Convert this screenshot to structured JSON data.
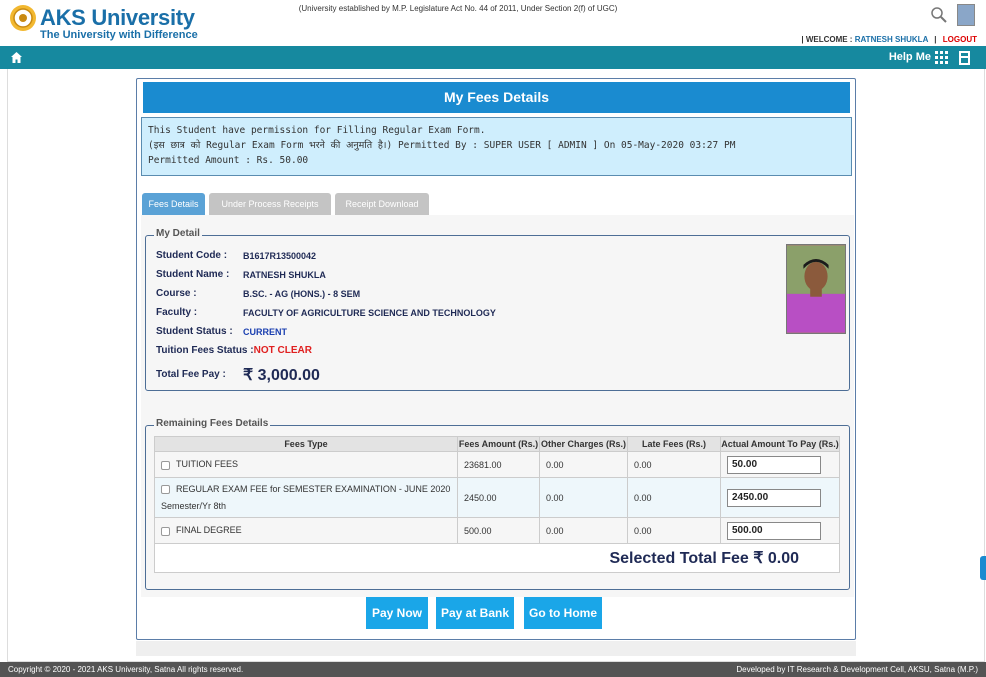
{
  "header": {
    "brand": "AKS University",
    "tagline": "The University with Difference",
    "establishment": "(University established by M.P. Legislature Act No. 44 of 2011, Under Section 2(f) of UGC)",
    "welcome_label": "WELCOME :",
    "user_name": "RATNESH SHUKLA",
    "logout": "LOGOUT",
    "sep": "|"
  },
  "nav": {
    "help": "Help Me"
  },
  "page": {
    "title": "My Fees Details",
    "notice_line1": "This Student have permission for Filling Regular Exam Form.",
    "notice_line2": "(इस छात्र को Regular Exam Form भरने की अनुमति है।) Permitted By : SUPER USER [ ADMIN ] On 05-May-2020 03:27 PM",
    "notice_line3": "Permitted Amount : Rs. 50.00"
  },
  "tabs": [
    "Fees Details",
    "Under Process Receipts",
    "Receipt Download"
  ],
  "detail": {
    "legend": "My Detail",
    "student_code_label": "Student Code :",
    "student_code": "B1617R13500042",
    "student_name_label": "Student Name :",
    "student_name": "RATNESH SHUKLA",
    "course_label": "Course :",
    "course": "B.SC. - AG (HONS.) - 8 SEM",
    "faculty_label": "Faculty :",
    "faculty": "FACULTY OF AGRICULTURE SCIENCE AND TECHNOLOGY",
    "status_label": "Student Status :",
    "status": "CURRENT",
    "tuition_label": "Tuition Fees Status :",
    "tuition_status": "NOT CLEAR",
    "total_label": "Total Fee Pay :",
    "total_value": "₹ 3,000.00"
  },
  "remaining": {
    "legend": "Remaining Fees Details",
    "headers": [
      "Fees Type",
      "Fees Amount (Rs.)",
      "Other Charges (Rs.)",
      "Late Fees (Rs.)",
      "Actual Amount To Pay (Rs.)"
    ],
    "rows": [
      {
        "type": "TUITION FEES",
        "sub": "",
        "amount": "23681.00",
        "other": "0.00",
        "late": "0.00",
        "pay": "50.00"
      },
      {
        "type": "REGULAR EXAM FEE for SEMESTER EXAMINATION - JUNE 2020",
        "sub": "Semester/Yr 8th",
        "amount": "2450.00",
        "other": "0.00",
        "late": "0.00",
        "pay": "2450.00"
      },
      {
        "type": "FINAL DEGREE",
        "sub": "",
        "amount": "500.00",
        "other": "0.00",
        "late": "0.00",
        "pay": "500.00"
      }
    ],
    "selected_total": "Selected Total Fee ₹ 0.00"
  },
  "buttons": {
    "pay_now": "Pay Now",
    "pay_bank": "Pay at Bank",
    "go_home": "Go to Home"
  },
  "footer": {
    "left": "Copyright © 2020 - 2021 AKS University, Satna All rights reserved.",
    "right": "Developed by IT Research & Development Cell, AKSU, Satna (M.P.)"
  },
  "colors": {
    "nav": "#16899f",
    "title_bar": "#1a8bd0",
    "button": "#1aa6e8",
    "alert": "#e02020"
  }
}
